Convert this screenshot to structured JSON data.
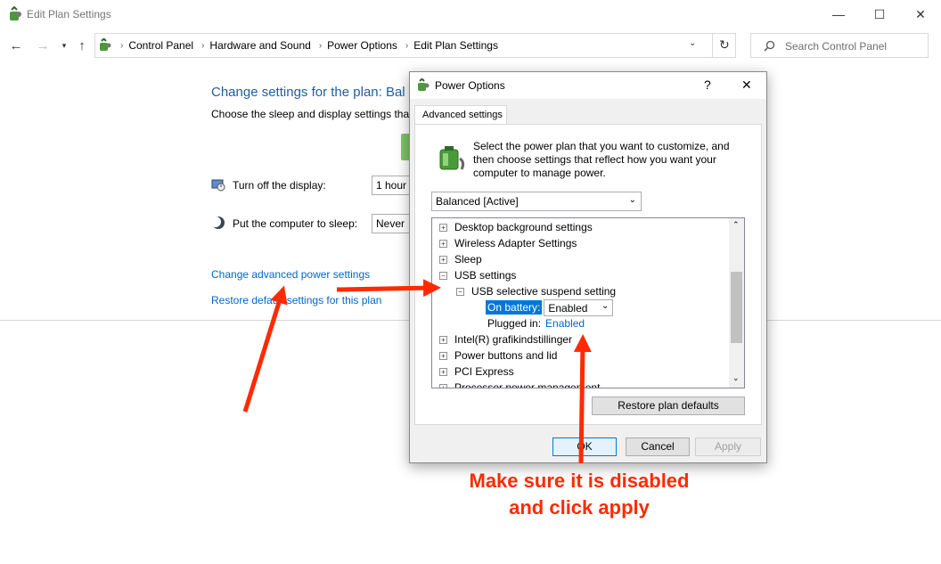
{
  "window": {
    "title": "Edit Plan Settings",
    "controls": {
      "minimize": "—",
      "maximize": "☐",
      "close": "✕"
    }
  },
  "nav": {
    "breadcrumbs": [
      "Control Panel",
      "Hardware and Sound",
      "Power Options",
      "Edit Plan Settings"
    ],
    "search_placeholder": "Search Control Panel"
  },
  "main": {
    "heading": "Change settings for the plan: Bal",
    "subheading": "Choose the sleep and display settings that",
    "display_label": "Turn off the display:",
    "display_value": "1 hour",
    "sleep_label": "Put the computer to sleep:",
    "sleep_value": "Never",
    "advanced_link": "Change advanced power settings",
    "restore_link": "Restore default settings for this plan"
  },
  "dialog": {
    "title": "Power Options",
    "help": "?",
    "close": "✕",
    "tab": "Advanced settings",
    "description": "Select the power plan that you want to customize, and then choose settings that reflect how you want your computer to manage power.",
    "plan_selected": "Balanced [Active]",
    "tree": [
      {
        "label": "Desktop background settings",
        "expanded": false,
        "level": 0
      },
      {
        "label": "Wireless Adapter Settings",
        "expanded": false,
        "level": 0
      },
      {
        "label": "Sleep",
        "expanded": false,
        "level": 0
      },
      {
        "label": "USB settings",
        "expanded": true,
        "level": 0
      },
      {
        "label": "USB selective suspend setting",
        "expanded": true,
        "level": 1
      },
      {
        "label": "Intel(R) grafikindstillinger",
        "expanded": false,
        "level": 0
      },
      {
        "label": "Power buttons and lid",
        "expanded": false,
        "level": 0
      },
      {
        "label": "PCI Express",
        "expanded": false,
        "level": 0
      },
      {
        "label": "Processor power management",
        "expanded": false,
        "level": 0
      }
    ],
    "on_battery_label": "On battery:",
    "on_battery_value": "Enabled",
    "plugged_in_label": "Plugged in:",
    "plugged_in_value": "Enabled",
    "restore_button": "Restore plan defaults",
    "ok_button": "OK",
    "cancel_button": "Cancel",
    "apply_button": "Apply"
  },
  "annotation": {
    "line1": "Make sure it is disabled",
    "line2": "and click apply",
    "color": "#ff2a00"
  }
}
